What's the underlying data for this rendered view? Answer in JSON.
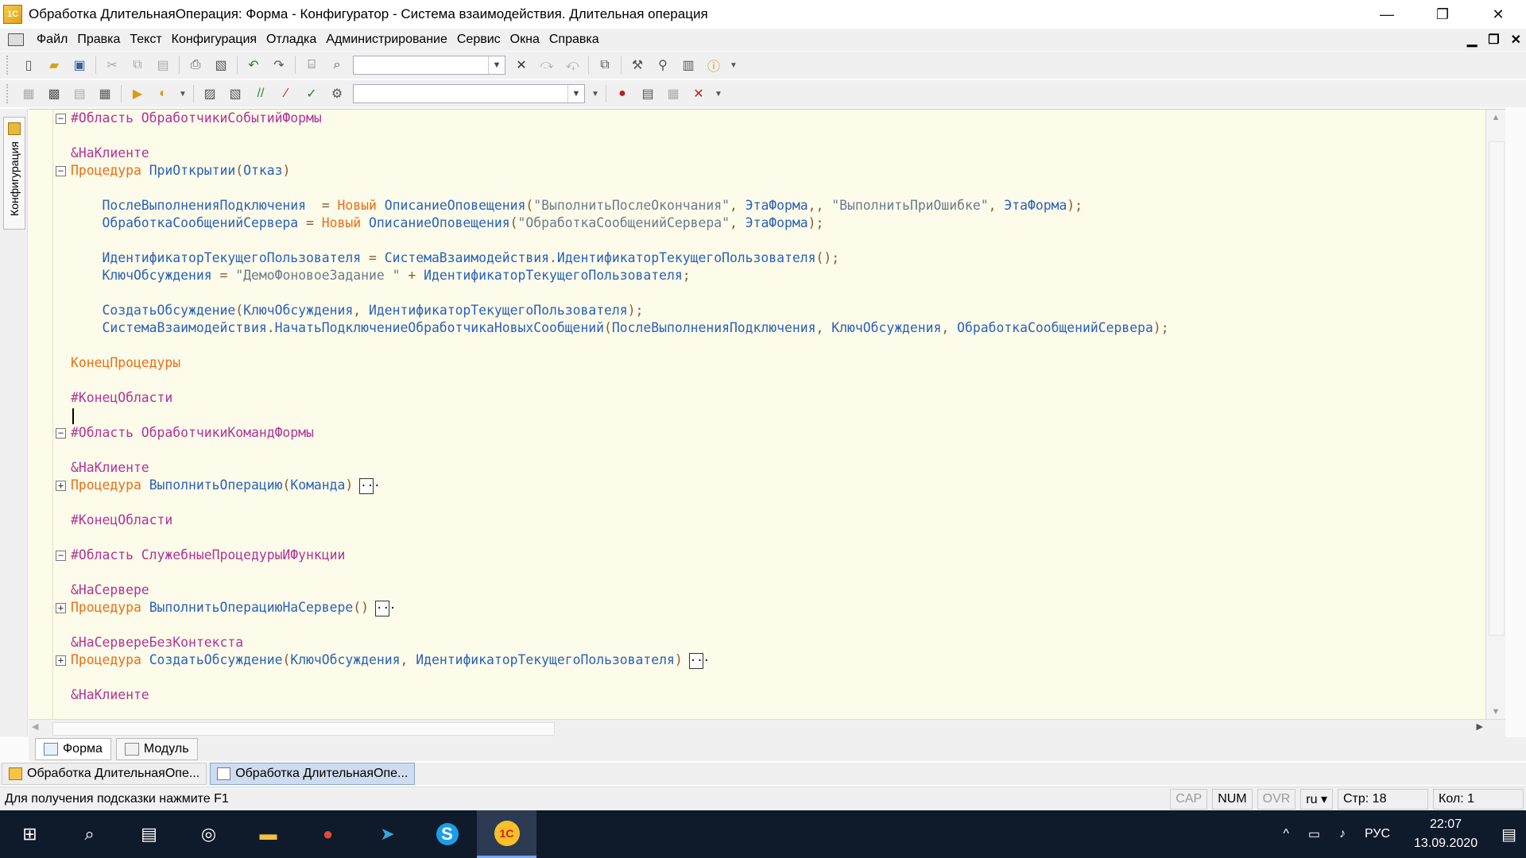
{
  "window": {
    "title": "Обработка ДлительнаяОперация: Форма - Конфигуратор - Система взаимодействия. Длительная операция",
    "controls": {
      "minimize": "—",
      "restore": "❐",
      "close": "✕"
    }
  },
  "menu": {
    "items": [
      "Файл",
      "Правка",
      "Текст",
      "Конфигурация",
      "Отладка",
      "Администрирование",
      "Сервис",
      "Окна",
      "Справка"
    ],
    "mdi": {
      "minimize": "▁",
      "restore": "❐",
      "close": "✕"
    }
  },
  "sidepanel": {
    "tab_label": "Конфигурация"
  },
  "code": {
    "lines": [
      {
        "segments": [
          [
            "pre",
            "#Область ОбработчикиСобытийФормы"
          ]
        ],
        "fold": "minus"
      },
      {
        "segments": []
      },
      {
        "segments": [
          [
            "pre",
            "&НаКлиенте"
          ]
        ]
      },
      {
        "segments": [
          [
            "kw",
            "Процедура "
          ],
          [
            "id",
            "ПриОткрытии"
          ],
          [
            "punct",
            "("
          ],
          [
            "id",
            "Отказ"
          ],
          [
            "punct",
            ")"
          ]
        ],
        "fold": "minus"
      },
      {
        "segments": []
      },
      {
        "segments": [
          [
            "id",
            "    ПослеВыполненияПодключения  "
          ],
          [
            "punct",
            "= "
          ],
          [
            "kw",
            "Новый "
          ],
          [
            "id",
            "ОписаниеОповещения"
          ],
          [
            "punct",
            "("
          ],
          [
            "str",
            "\"ВыполнитьПослеОкончания\""
          ],
          [
            "punct",
            ", "
          ],
          [
            "id",
            "ЭтаФорма"
          ],
          [
            "punct",
            ",, "
          ],
          [
            "str",
            "\"ВыполнитьПриОшибке\""
          ],
          [
            "punct",
            ", "
          ],
          [
            "id",
            "ЭтаФорма"
          ],
          [
            "punct",
            ");"
          ]
        ]
      },
      {
        "segments": [
          [
            "id",
            "    ОбработкаСообщенийСервера "
          ],
          [
            "punct",
            "= "
          ],
          [
            "kw",
            "Новый "
          ],
          [
            "id",
            "ОписаниеОповещения"
          ],
          [
            "punct",
            "("
          ],
          [
            "str",
            "\"ОбработкаСообщенийСервера\""
          ],
          [
            "punct",
            ", "
          ],
          [
            "id",
            "ЭтаФорма"
          ],
          [
            "punct",
            ");"
          ]
        ]
      },
      {
        "segments": []
      },
      {
        "segments": [
          [
            "id",
            "    ИдентификаторТекущегоПользователя "
          ],
          [
            "punct",
            "= "
          ],
          [
            "id",
            "СистемаВзаимодействия"
          ],
          [
            "punct",
            "."
          ],
          [
            "id",
            "ИдентификаторТекущегоПользователя"
          ],
          [
            "punct",
            "();"
          ]
        ]
      },
      {
        "segments": [
          [
            "id",
            "    КлючОбсуждения "
          ],
          [
            "punct",
            "= "
          ],
          [
            "str",
            "\"ДемоФоновоеЗадание \""
          ],
          [
            "punct",
            " + "
          ],
          [
            "id",
            "ИдентификаторТекущегоПользователя"
          ],
          [
            "punct",
            ";"
          ]
        ]
      },
      {
        "segments": []
      },
      {
        "segments": [
          [
            "id",
            "    СоздатьОбсуждение"
          ],
          [
            "punct",
            "("
          ],
          [
            "id",
            "КлючОбсуждения"
          ],
          [
            "punct",
            ", "
          ],
          [
            "id",
            "ИдентификаторТекущегоПользователя"
          ],
          [
            "punct",
            ");"
          ]
        ]
      },
      {
        "segments": [
          [
            "id",
            "    СистемаВзаимодействия"
          ],
          [
            "punct",
            "."
          ],
          [
            "id",
            "НачатьПодключениеОбработчикаНовыхСообщений"
          ],
          [
            "punct",
            "("
          ],
          [
            "id",
            "ПослеВыполненияПодключения"
          ],
          [
            "punct",
            ", "
          ],
          [
            "id",
            "КлючОбсуждения"
          ],
          [
            "punct",
            ", "
          ],
          [
            "id",
            "ОбработкаСообщенийСервера"
          ],
          [
            "punct",
            ");"
          ]
        ]
      },
      {
        "segments": []
      },
      {
        "segments": [
          [
            "kw",
            "КонецПроцедуры"
          ]
        ]
      },
      {
        "segments": []
      },
      {
        "segments": [
          [
            "pre",
            "#КонецОбласти"
          ]
        ]
      },
      {
        "segments": [],
        "cursor": true
      },
      {
        "segments": [
          [
            "pre",
            "#Область ОбработчикиКомандФормы"
          ]
        ],
        "fold": "minus"
      },
      {
        "segments": []
      },
      {
        "segments": [
          [
            "pre",
            "&НаКлиенте"
          ]
        ]
      },
      {
        "segments": [
          [
            "kw",
            "Процедура "
          ],
          [
            "id",
            "ВыполнитьОперацию"
          ],
          [
            "punct",
            "("
          ],
          [
            "id",
            "Команда"
          ],
          [
            "punct",
            ")"
          ]
        ],
        "fold": "plus",
        "collapsed": true
      },
      {
        "segments": []
      },
      {
        "segments": [
          [
            "pre",
            "#КонецОбласти"
          ]
        ]
      },
      {
        "segments": []
      },
      {
        "segments": [
          [
            "pre",
            "#Область СлужебныеПроцедурыИФункции"
          ]
        ],
        "fold": "minus"
      },
      {
        "segments": []
      },
      {
        "segments": [
          [
            "pre",
            "&НаСервере"
          ]
        ]
      },
      {
        "segments": [
          [
            "kw",
            "Процедура "
          ],
          [
            "id",
            "ВыполнитьОперациюНаСервере"
          ],
          [
            "punct",
            "()"
          ]
        ],
        "fold": "plus",
        "collapsed": true
      },
      {
        "segments": []
      },
      {
        "segments": [
          [
            "pre",
            "&НаСервереБезКонтекста"
          ]
        ]
      },
      {
        "segments": [
          [
            "kw",
            "Процедура "
          ],
          [
            "id",
            "СоздатьОбсуждение"
          ],
          [
            "punct",
            "("
          ],
          [
            "id",
            "КлючОбсуждения"
          ],
          [
            "punct",
            ", "
          ],
          [
            "id",
            "ИдентификаторТекущегоПользователя"
          ],
          [
            "punct",
            ")"
          ]
        ],
        "fold": "plus",
        "collapsed": true
      },
      {
        "segments": []
      },
      {
        "segments": [
          [
            "pre",
            "&НаКлиенте"
          ]
        ]
      }
    ],
    "collapsed_marker": "..."
  },
  "form_tabs": [
    {
      "label": "Форма",
      "active": true
    },
    {
      "label": "Модуль",
      "active": false
    }
  ],
  "window_tabs": [
    {
      "label": "Обработка ДлительнаяОпе...",
      "active": false
    },
    {
      "label": "Обработка ДлительнаяОпе...",
      "active": true
    }
  ],
  "status": {
    "hint": "Для получения подсказки нажмите F1",
    "cap": "CAP",
    "num": "NUM",
    "ovr": "OVR",
    "lang": "ru ▾",
    "line": "Стр: 18",
    "col": "Кол: 1"
  },
  "taskbar": {
    "apps": [
      {
        "name": "start-icon",
        "glyph": "⊞"
      },
      {
        "name": "search-icon",
        "glyph": "⌕"
      },
      {
        "name": "task-view-icon",
        "glyph": "▤"
      },
      {
        "name": "steam-icon",
        "glyph": "◎"
      },
      {
        "name": "folder-icon",
        "glyph": "▬"
      },
      {
        "name": "chrome-icon",
        "glyph": "●"
      },
      {
        "name": "telegram-icon",
        "glyph": "➤"
      },
      {
        "name": "skype-icon",
        "glyph": "S"
      },
      {
        "name": "1c-icon",
        "glyph": "1С"
      }
    ],
    "tray": {
      "chevron": "^",
      "lang": "РУС"
    },
    "time": "22:07",
    "date": "13.09.2020"
  }
}
